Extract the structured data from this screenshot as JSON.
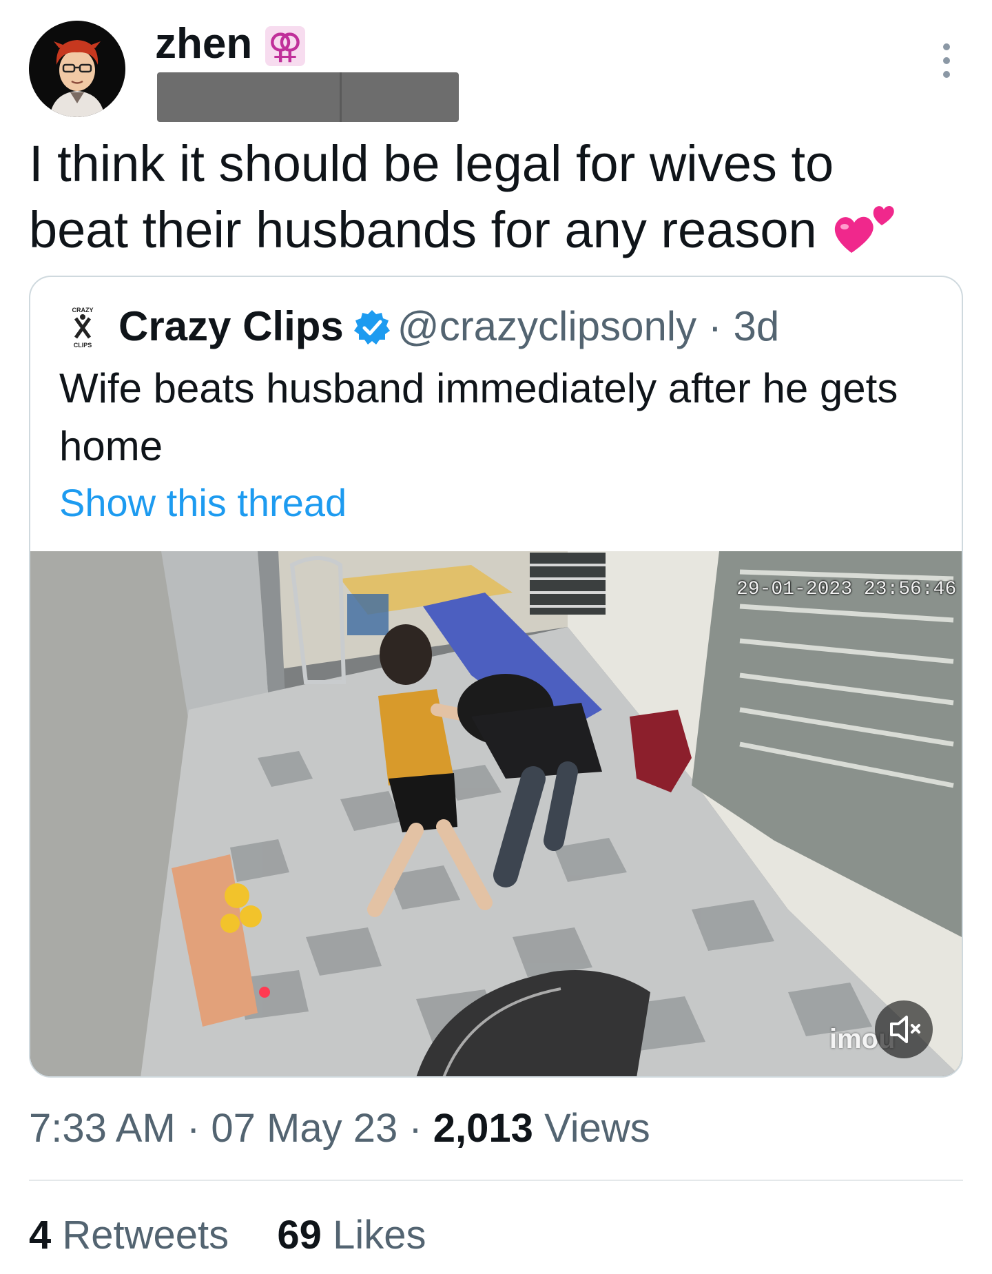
{
  "author": {
    "name": "zhen",
    "badge": "⚢",
    "avatar_icon": "cartoon-avatar-icon"
  },
  "tweet": {
    "text": "I think it should be legal for wives to beat their husbands for any reason",
    "emoji": "two-hearts-icon"
  },
  "quote": {
    "name": "Crazy Clips",
    "handle": "@crazyclipsonly",
    "separator": "·",
    "age": "3d",
    "text": "Wife beats husband immediately after he gets home",
    "show_thread": "Show this thread",
    "media": {
      "timestamp": "29-01-2023 23:56:46",
      "watermark": "imou",
      "mute_icon": "volume-muted-icon"
    }
  },
  "meta": {
    "time": "7:33 AM",
    "separator": "·",
    "date": "07 May 23",
    "views_count": "2,013",
    "views_label": "Views"
  },
  "engagement": {
    "retweets_count": "4",
    "retweets_label": "Retweets",
    "likes_count": "69",
    "likes_label": "Likes"
  },
  "colors": {
    "text": "#0f1419",
    "secondary": "#536471",
    "link": "#1d9bf0",
    "border": "#cfd9de",
    "verified": "#1d9bf0"
  }
}
